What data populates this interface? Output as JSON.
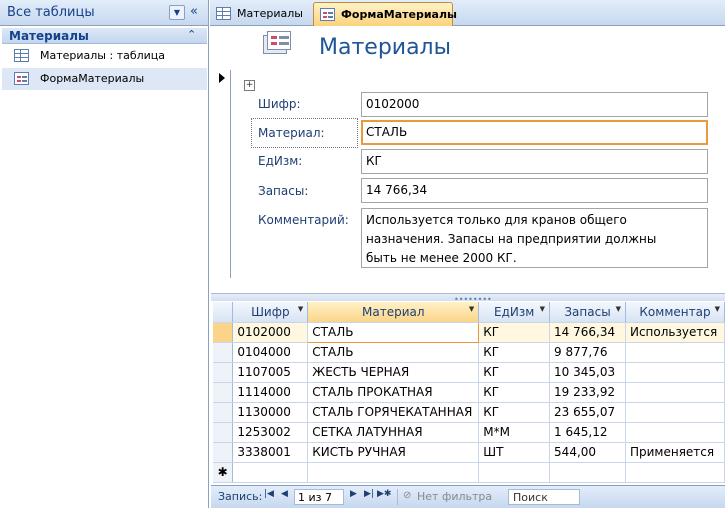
{
  "nav": {
    "title": "Все таблицы",
    "group_title": "Материалы",
    "items": [
      {
        "label": "Материалы : таблица",
        "type": "table"
      },
      {
        "label": "ФормаМатериалы",
        "type": "form"
      }
    ]
  },
  "tabs": [
    {
      "label": "Материалы",
      "active": false
    },
    {
      "label": "ФормаМатериалы",
      "active": true
    }
  ],
  "form": {
    "title": "Материалы",
    "fields": [
      {
        "label": "Шифр:",
        "value": "0102000"
      },
      {
        "label": "Материал:",
        "value": "СТАЛЬ"
      },
      {
        "label": "ЕдИзм:",
        "value": "КГ"
      },
      {
        "label": "Запасы:",
        "value": "14 766,34"
      },
      {
        "label": "Комментарий:",
        "value": "Используется только для кранов общего\nназначения. Запасы на предприятии должны\nбыть не менее 2000 КГ."
      }
    ]
  },
  "datasheet": {
    "columns": [
      "Шифр",
      "Материал",
      "ЕдИзм",
      "Запасы",
      "Комментар"
    ],
    "rows": [
      [
        "0102000",
        "СТАЛЬ",
        "КГ",
        "14 766,34",
        "Используется"
      ],
      [
        "0104000",
        "СТАЛЬ",
        "КГ",
        "9 877,76",
        ""
      ],
      [
        "1107005",
        "ЖЕСТЬ ЧЕРНАЯ",
        "КГ",
        "10 345,03",
        ""
      ],
      [
        "1114000",
        "СТАЛЬ ПРОКАТНАЯ",
        "КГ",
        "19 233,92",
        ""
      ],
      [
        "1130000",
        "СТАЛЬ ГОРЯЧЕКАТАННАЯ",
        "КГ",
        "23 655,07",
        ""
      ],
      [
        "1253002",
        "СЕТКА ЛАТУННАЯ",
        "М*М",
        "1 645,12",
        ""
      ],
      [
        "3338001",
        "КИСТЬ РУЧНАЯ",
        "ШТ",
        "544,00",
        "Применяется"
      ]
    ],
    "new_row_marker": "✱"
  },
  "recnav": {
    "label": "Запись:",
    "position": "1 из 7",
    "filter": "Нет фильтра",
    "search": "Поиск"
  },
  "colors": {
    "accent": "#1f5597",
    "active_border": "#e89a3c",
    "nav_bg": "#c6d8ef"
  }
}
